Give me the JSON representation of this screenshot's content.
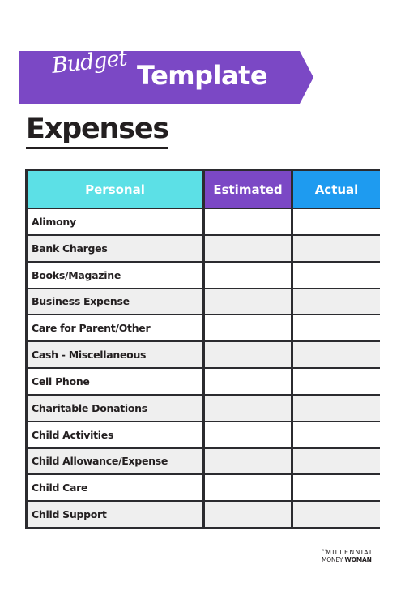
{
  "banner": {
    "script_word": "Budget",
    "title": "Template",
    "color": "#7b48c5"
  },
  "heading": "Expenses",
  "table": {
    "headers": [
      {
        "label": "Personal",
        "color": "#5ce0e6"
      },
      {
        "label": "Estimated",
        "color": "#7b48c5"
      },
      {
        "label": "Actual",
        "color": "#1e9bf0"
      }
    ],
    "rows": [
      {
        "category": "Alimony",
        "estimated": "",
        "actual": ""
      },
      {
        "category": "Bank Charges",
        "estimated": "",
        "actual": ""
      },
      {
        "category": "Books/Magazine",
        "estimated": "",
        "actual": ""
      },
      {
        "category": "Business Expense",
        "estimated": "",
        "actual": ""
      },
      {
        "category": "Care for Parent/Other",
        "estimated": "",
        "actual": ""
      },
      {
        "category": "Cash - Miscellaneous",
        "estimated": "",
        "actual": ""
      },
      {
        "category": "Cell Phone",
        "estimated": "",
        "actual": ""
      },
      {
        "category": "Charitable Donations",
        "estimated": "",
        "actual": ""
      },
      {
        "category": "Child Activities",
        "estimated": "",
        "actual": ""
      },
      {
        "category": "Child Allowance/Expense",
        "estimated": "",
        "actual": ""
      },
      {
        "category": "Child Care",
        "estimated": "",
        "actual": ""
      },
      {
        "category": "Child Support",
        "estimated": "",
        "actual": ""
      }
    ]
  },
  "logo": {
    "the": "THE",
    "line1": "MILLENNIAL",
    "line2_light": "MONEY",
    "line2_bold": "WOMAN"
  }
}
